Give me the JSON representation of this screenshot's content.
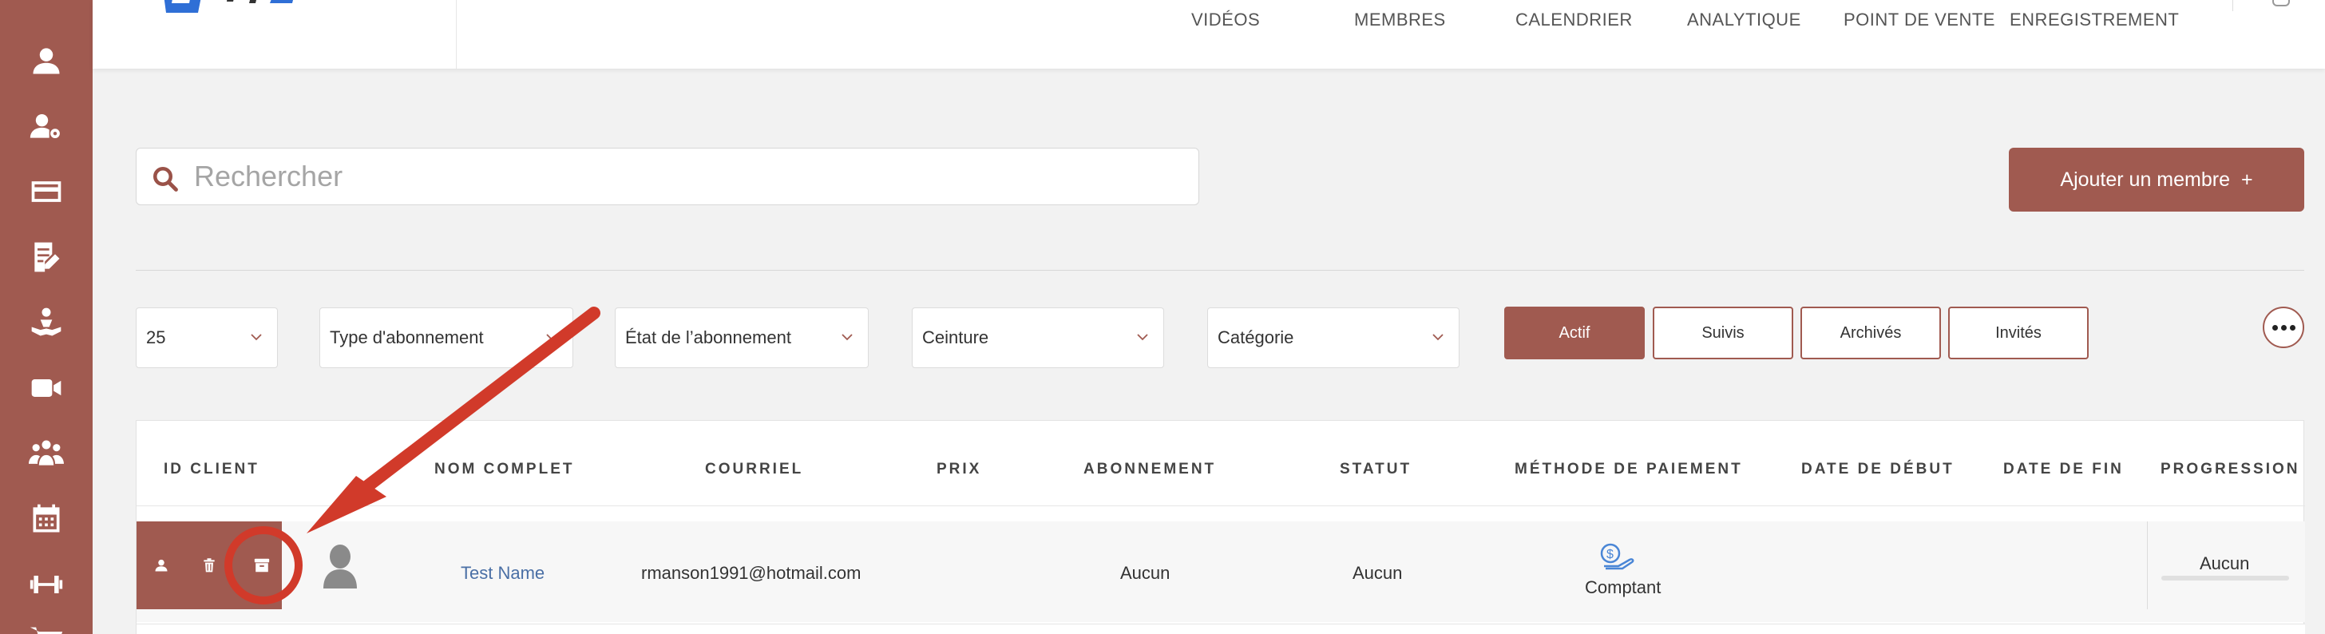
{
  "sidebar": {
    "icons": [
      "user-icon",
      "user-settings-icon",
      "credit-card-icon",
      "edit-document-icon",
      "training-icon",
      "video-camera-icon",
      "group-icon",
      "calendar-icon",
      "dumbbell-icon",
      "cart-icon"
    ]
  },
  "header": {
    "nav": [
      "VIDÉOS",
      "MEMBRES",
      "CALENDRIER",
      "ANALYTIQUE",
      "POINT DE VENTE",
      "ENREGISTREMENT"
    ]
  },
  "search": {
    "placeholder": "Rechercher"
  },
  "add_member": {
    "label": "Ajouter un membre",
    "icon": "+"
  },
  "filters": {
    "page_size": "25",
    "subscription_type": "Type d'abonnement",
    "subscription_state": "État de l’abonnement",
    "belt": "Ceinture",
    "category": "Catégorie"
  },
  "tabs": [
    {
      "label": "Actif",
      "active": true
    },
    {
      "label": "Suivis",
      "active": false
    },
    {
      "label": "Archivés",
      "active": false
    },
    {
      "label": "Invités",
      "active": false
    }
  ],
  "table": {
    "columns": [
      "ID CLIENT",
      "NOM COMPLET",
      "COURRIEL",
      "PRIX",
      "ABONNEMENT",
      "STATUT",
      "MÉTHODE DE PAIEMENT",
      "DATE DE DÉBUT",
      "DATE DE FIN",
      "PROGRESSION"
    ],
    "rows": [
      {
        "name": "Test Name",
        "email": "rmanson1991@hotmail.com",
        "price": "",
        "subscription": "Aucun",
        "status": "Aucun",
        "payment_method": "Comptant",
        "start_date": "",
        "end_date": "",
        "progression": "Aucun"
      }
    ]
  },
  "colors": {
    "brand": "#a05a50",
    "annotation": "#d13a2a",
    "link": "#4a6fa5"
  }
}
